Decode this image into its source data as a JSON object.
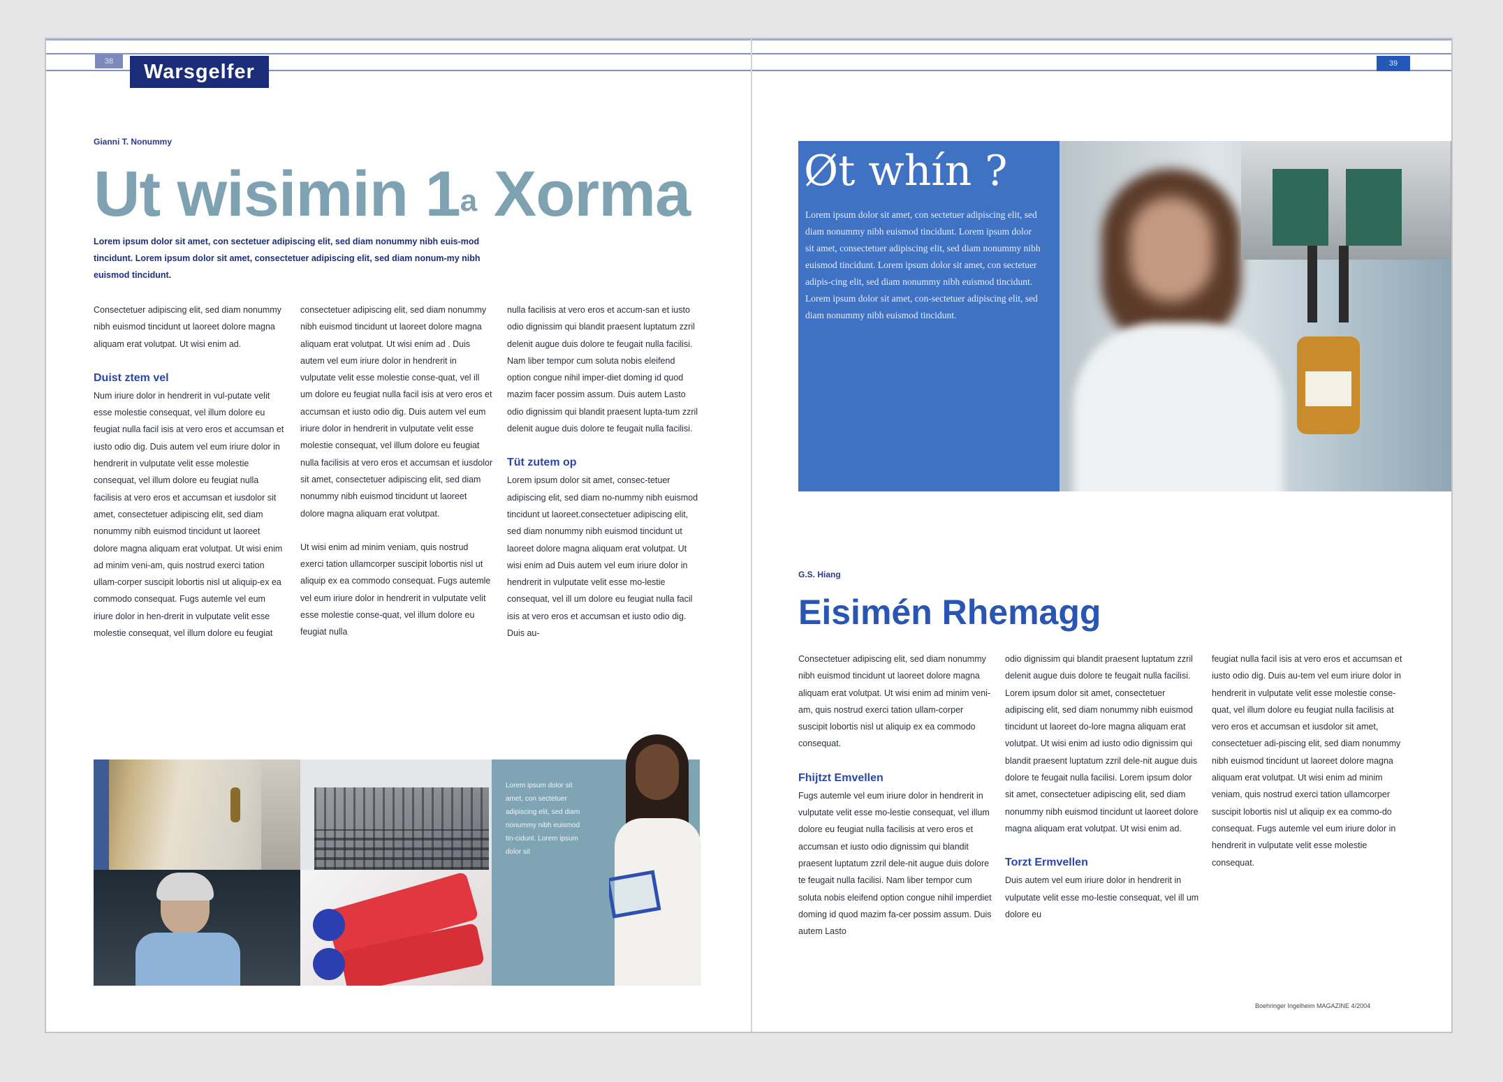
{
  "left_page": {
    "page_number": "38",
    "section": "Warsgelfer",
    "author": "Gianni T. Nonummy",
    "headline_main": "Ut wisimin 1",
    "headline_sup": "a",
    "headline_tail": " Xorma",
    "lead": "Lorem ipsum dolor sit amet, con sectetuer adipiscing elit, sed diam nonummy nibh euis-mod tincidunt. Lorem ipsum dolor sit amet, consectetuer adipiscing elit, sed diam nonum-my nibh euismod tincidunt.",
    "col1_p1": "Consectetuer adipiscing elit, sed diam nonummy nibh euismod tincidunt ut laoreet dolore magna aliquam erat volutpat. Ut wisi enim ad.",
    "col1_h": "Duist ztem vel",
    "col1_p2": "Num iriure dolor in hendrerit in vul-putate velit esse molestie consequat, vel illum dolore eu feugiat nulla facil isis at vero eros et accumsan et iusto odio dig. Duis autem vel eum iriure dolor in hendrerit in vulputate velit esse molestie consequat, vel illum dolore eu feugiat nulla facilisis at vero eros et accumsan et iusdolor sit amet, consectetuer adipiscing elit, sed diam nonummy nibh euismod tincidunt ut laoreet dolore magna aliquam erat volutpat. Ut wisi enim ad minim veni-am, quis nostrud exerci tation ullam-corper suscipit lobortis nisl ut aliquip-ex ea commodo consequat. Fugs autemle vel eum iriure dolor in hen-drerit in vulputate velit esse molestie consequat, vel illum dolore eu feugiat",
    "col2_p1": "consectetuer adipiscing elit, sed diam nonummy nibh euismod tincidunt ut laoreet dolore magna aliquam erat volutpat. Ut wisi enim ad . Duis autem vel eum iriure dolor in hendrerit in vulputate velit esse molestie conse-quat, vel ill um dolore eu feugiat nulla facil isis at vero eros et accumsan et iusto odio dig. Duis autem vel eum iriure dolor in hendrerit in vulputate velit esse molestie consequat, vel illum dolore eu feugiat nulla facilisis at vero eros et accumsan et iusdolor sit amet, consectetuer adipiscing elit, sed diam nonummy nibh euismod tincidunt ut laoreet dolore magna aliquam erat volutpat.",
    "col2_p2": "Ut wisi enim ad minim veniam, quis nostrud exerci tation ullamcorper suscipit lobortis nisl ut aliquip ex ea commodo consequat. Fugs autemle vel eum iriure dolor in hendrerit in vulputate velit esse molestie conse-quat, vel illum dolore eu feugiat nulla",
    "col3_p1": "nulla facilisis at vero eros et accum-san et iusto odio dignissim qui blandit praesent luptatum zzril delenit augue duis dolore te feugait nulla facilisi. Nam liber tempor cum soluta nobis eleifend option congue nihil imper-diet doming id quod mazim facer possim assum. Duis autem Lasto odio dignissim qui blandit praesent lupta-tum zzril delenit augue duis dolore te feugait nulla facilisi.",
    "col3_h": "Tüt zutem op",
    "col3_p2": "Lorem ipsum dolor sit amet, consec-tetuer adipiscing elit, sed diam no-nummy nibh euismod tincidunt ut laoreet.consectetuer adipiscing elit, sed diam nonummy nibh euismod tincidunt ut laoreet dolore magna aliquam erat volutpat. Ut wisi enim ad Duis autem vel eum iriure dolor in hendrerit in vulputate velit esse mo-lestie consequat, vel ill um dolore eu feugiat nulla facil isis at vero eros et accumsan et iusto odio dig. Duis au-",
    "photo_caption": "Lorem ipsum dolor sit amet, con sectetuer adipiscing elit, sed diam nonummy nibh euismod tin-cidunt. Lorem ipsum dolor sit"
  },
  "right_page": {
    "page_number": "39",
    "hero_title": "Øt whín ?",
    "hero_text": "Lorem ipsum dolor sit amet, con sectetuer adipiscing elit, sed diam nonummy nibh euismod tincidunt. Lorem ipsum dolor sit amet, consectetuer adipiscing elit, sed diam nonummy nibh euismod tincidunt. Lorem ipsum dolor sit amet, con sectetuer adipis-cing elit, sed diam nonummy nibh euismod tincidunt. Lorem ipsum dolor sit amet, con-sectetuer adipiscing elit, sed diam nonummy nibh euismod tincidunt.",
    "author": "G.S. Hiang",
    "headline": "Eisimén Rhemagg",
    "col1_p1": "Consectetuer adipiscing elit, sed diam nonummy nibh euismod tincidunt ut laoreet dolore magna aliquam erat volutpat. Ut wisi enim ad minim veni-am, quis nostrud exerci tation ullam-corper suscipit lobortis nisl ut aliquip ex ea commodo consequat.",
    "col1_h": "Fhijtzt Emvellen",
    "col1_p2": "Fugs autemle vel eum iriure dolor in hendrerit in vulputate velit esse mo-lestie consequat, vel illum dolore eu feugiat nulla facilisis at vero eros et accumsan et iusto odio dignissim qui blandit praesent luptatum zzril dele-nit augue duis dolore te feugait nulla facilisi. Nam liber tempor cum soluta nobis eleifend option congue nihil imperdiet doming id quod mazim fa-cer possim assum. Duis autem Lasto",
    "col2_p1": "odio dignissim qui blandit praesent luptatum zzril delenit augue duis dolore te feugait nulla facilisi. Lorem ipsum dolor sit amet, consectetuer adipiscing elit, sed diam nonummy nibh euismod tincidunt ut laoreet do-lore magna aliquam erat volutpat. Ut wisi enim ad iusto odio dignissim qui blandit praesent luptatum zzril dele-nit augue duis dolore te feugait nulla facilisi. Lorem ipsum dolor sit amet, consectetuer adipiscing elit, sed diam nonummy nibh euismod tincidunt ut laoreet dolore magna aliquam erat volutpat. Ut wisi enim ad.",
    "col2_h": "Torzt Ermvellen",
    "col2_p2": "Duis autem vel eum iriure dolor in hendrerit in vulputate velit esse mo-lestie consequat, vel ill um dolore eu",
    "col3_p1": "feugiat nulla facil isis at vero eros et accumsan et iusto odio dig. Duis au-tem vel eum iriure dolor in hendrerit in vulputate velit esse molestie conse-quat, vel illum dolore eu feugiat nulla facilisis at vero eros et accumsan et iusdolor sit amet, consectetuer adi-piscing elit, sed diam nonummy nibh euismod tincidunt ut laoreet dolore magna aliquam erat volutpat. Ut wisi enim ad minim veniam, quis nostrud exerci tation ullamcorper suscipit lobortis nisl ut aliquip ex ea commo-do consequat. Fugs autemle vel eum iriure dolor in hendrerit in vulputate velit esse molestie consequat.",
    "footer": "Boehringer Ingelheim  MAGAZINE  4/2004"
  },
  "colors": {
    "rule": "#7f8fc3",
    "section_tab": "#1b2c79",
    "headline_left": "#7fa2b2",
    "headline_right": "#2856b2",
    "hero_blue": "#3f72c3",
    "caption_panel": "#7fa5b5"
  }
}
